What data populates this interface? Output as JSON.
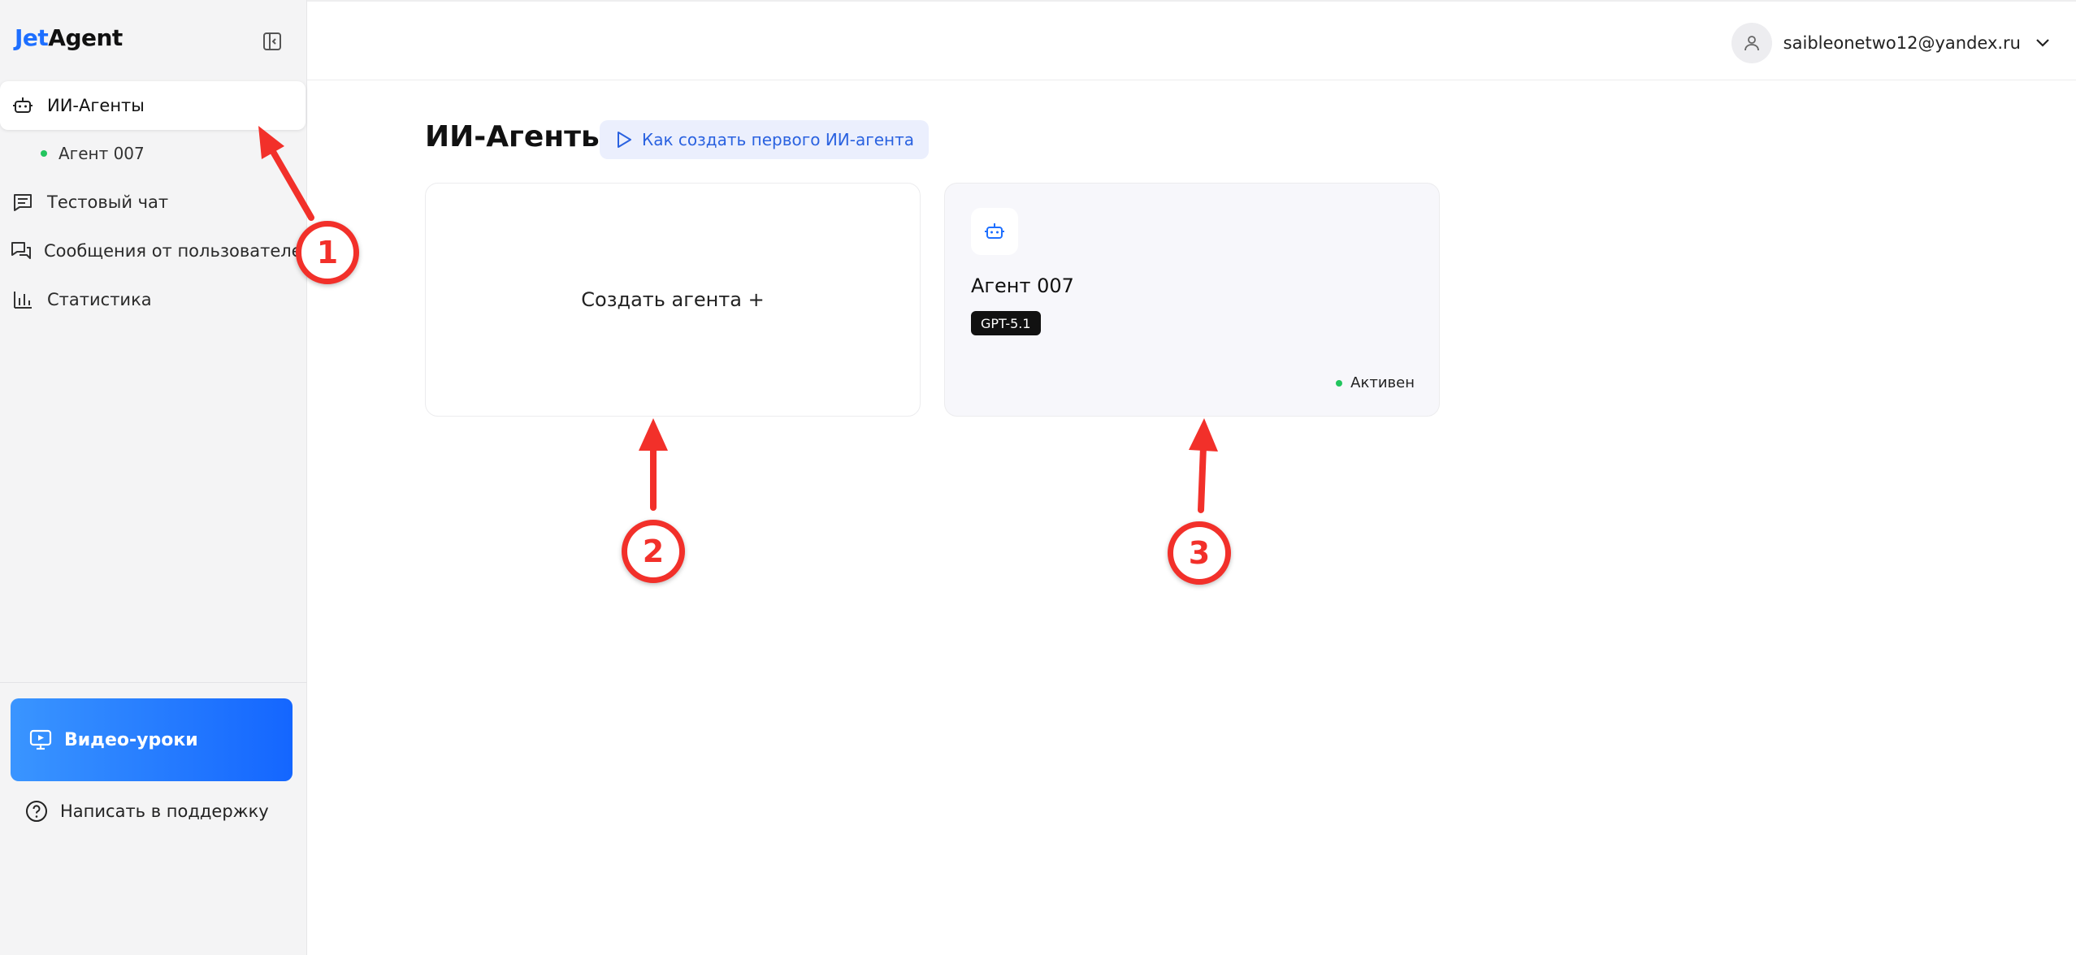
{
  "app": {
    "logo_part1": "Jet",
    "logo_part2": "Agent"
  },
  "sidebar": {
    "items": [
      {
        "label": "ИИ-Агенты",
        "icon": "robot-icon",
        "active": true
      },
      {
        "label": "Агент 007",
        "icon": "status-dot",
        "sub": true
      },
      {
        "label": "Тестовый чат",
        "icon": "chat-lines-icon"
      },
      {
        "label": "Сообщения от пользователей",
        "icon": "messages-icon"
      },
      {
        "label": "Статистика",
        "icon": "bar-chart-icon"
      }
    ],
    "video_button": "Видео-уроки",
    "support_link": "Написать в поддержку"
  },
  "header": {
    "user_email": "saibleonetwo12@yandex.ru"
  },
  "main": {
    "title": "ИИ-Агенты",
    "howto_button": "Как создать первого ИИ-агента",
    "create_card_label": "Создать агента +",
    "agent_card": {
      "name": "Агент 007",
      "model": "GPT-5.1",
      "status": "Активен"
    }
  },
  "annotations": [
    "1",
    "2",
    "3"
  ],
  "colors": {
    "accent": "#1e6fff",
    "annotation": "#f2302a",
    "status_active": "#22c55e"
  }
}
